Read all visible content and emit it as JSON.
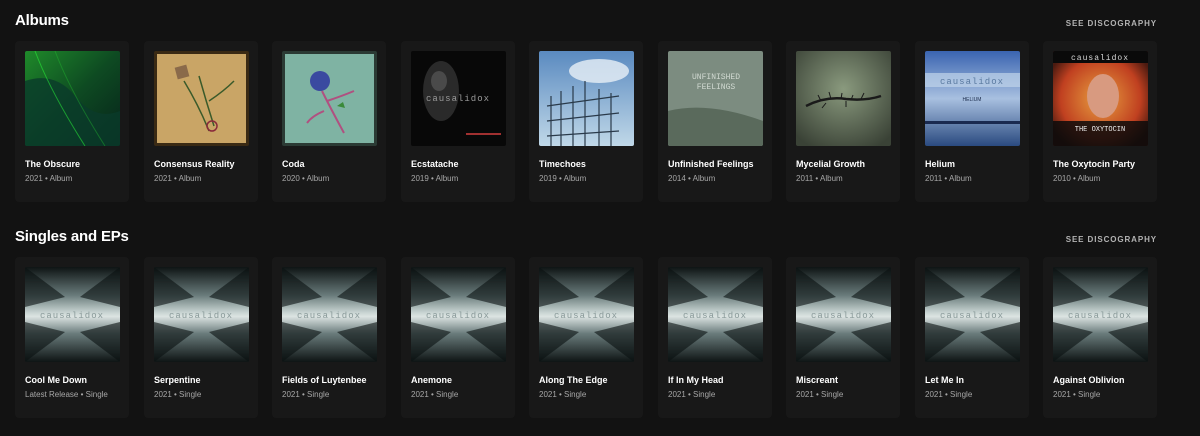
{
  "albums": {
    "title": "Albums",
    "see_all": "SEE DISCOGRAPHY",
    "items": [
      {
        "title": "The Obscure",
        "year": "2021",
        "type": "Album"
      },
      {
        "title": "Consensus Reality",
        "year": "2021",
        "type": "Album"
      },
      {
        "title": "Coda",
        "year": "2020",
        "type": "Album"
      },
      {
        "title": "Ecstatache",
        "year": "2019",
        "type": "Album"
      },
      {
        "title": "Timechoes",
        "year": "2019",
        "type": "Album"
      },
      {
        "title": "Unfinished Feelings",
        "year": "2014",
        "type": "Album"
      },
      {
        "title": "Mycelial Growth",
        "year": "2011",
        "type": "Album"
      },
      {
        "title": "Helium",
        "year": "2011",
        "type": "Album"
      },
      {
        "title": "The Oxytocin Party",
        "year": "2010",
        "type": "Album"
      }
    ]
  },
  "singles": {
    "title": "Singles and EPs",
    "see_all": "SEE DISCOGRAPHY",
    "items": [
      {
        "title": "Cool Me Down",
        "year": "Latest Release",
        "type": "Single"
      },
      {
        "title": "Serpentine",
        "year": "2021",
        "type": "Single"
      },
      {
        "title": "Fields of Luytenbee",
        "year": "2021",
        "type": "Single"
      },
      {
        "title": "Anemone",
        "year": "2021",
        "type": "Single"
      },
      {
        "title": "Along The Edge",
        "year": "2021",
        "type": "Single"
      },
      {
        "title": "If In My Head",
        "year": "2021",
        "type": "Single"
      },
      {
        "title": "Miscreant",
        "year": "2021",
        "type": "Single"
      },
      {
        "title": "Let Me In",
        "year": "2021",
        "type": "Single"
      },
      {
        "title": "Against Oblivion",
        "year": "2021",
        "type": "Single"
      }
    ]
  },
  "cover_text": {
    "brand": "causalidox",
    "helium": "HELIUM",
    "oxytocin": "THE OXYTOCIN",
    "unfinished_1": "UNFINISHED",
    "unfinished_2": "FEELINGS"
  },
  "colors": {
    "background": "#121212",
    "card": "#181818",
    "text": "#ffffff",
    "subtext": "#a7a7a7"
  }
}
